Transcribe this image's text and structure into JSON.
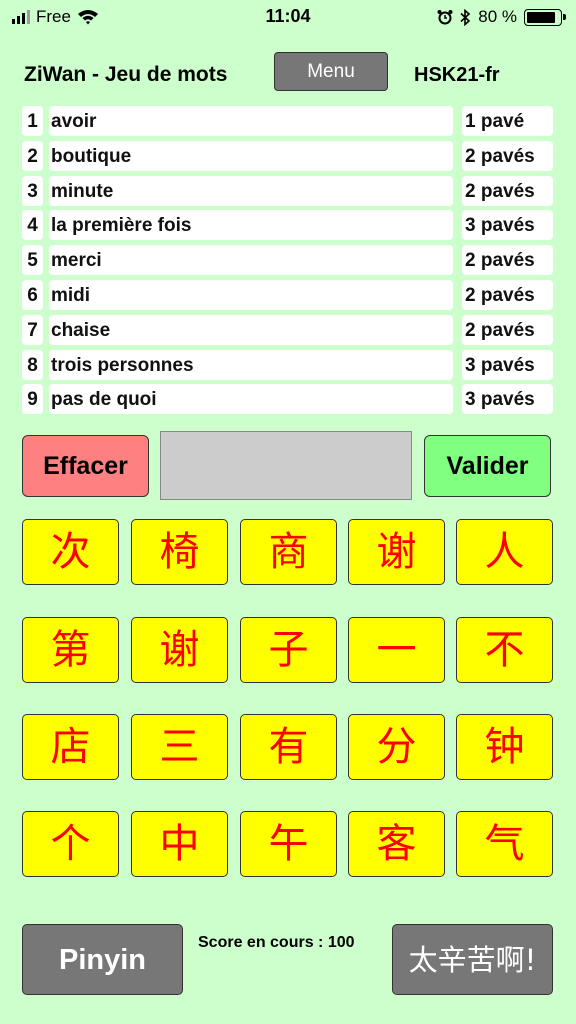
{
  "status_bar": {
    "carrier": "Free",
    "time": "11:04",
    "battery": "80 %",
    "battery_level": 0.8,
    "icons": [
      "signal-icon",
      "wifi-icon",
      "alarm-icon",
      "bluetooth-icon",
      "battery-icon"
    ]
  },
  "header": {
    "title": "ZiWan - Jeu de mots",
    "menu_label": "Menu",
    "level": "HSK21-fr"
  },
  "words": [
    {
      "num": "1",
      "text": "avoir",
      "count": "1 pavé"
    },
    {
      "num": "2",
      "text": "boutique",
      "count": "2 pavés"
    },
    {
      "num": "3",
      "text": "minute",
      "count": "2 pavés"
    },
    {
      "num": "4",
      "text": "la première fois",
      "count": "3 pavés"
    },
    {
      "num": "5",
      "text": "merci",
      "count": "2 pavés"
    },
    {
      "num": "6",
      "text": "midi",
      "count": "2 pavés"
    },
    {
      "num": "7",
      "text": "chaise",
      "count": "2 pavés"
    },
    {
      "num": "8",
      "text": "trois personnes",
      "count": "3 pavés"
    },
    {
      "num": "9",
      "text": "pas de quoi",
      "count": "3 pavés"
    }
  ],
  "controls": {
    "clear_label": "Effacer",
    "answer_value": "",
    "validate_label": "Valider"
  },
  "tiles": [
    [
      "次",
      "椅",
      "商",
      "谢",
      "人"
    ],
    [
      "第",
      "谢",
      "子",
      "一",
      "不"
    ],
    [
      "店",
      "三",
      "有",
      "分",
      "钟"
    ],
    [
      "个",
      "中",
      "午",
      "客",
      "气"
    ]
  ],
  "footer": {
    "pinyin_label": "Pinyin",
    "score_text": "Score en cours : 100",
    "hard_label": "太辛苦啊!"
  },
  "colors": {
    "background": "#ccffcc",
    "tile_bg": "#ffff00",
    "tile_text": "#ff0000",
    "clear_btn": "#ff8080",
    "validate_btn": "#80ff80",
    "gray_btn": "#777777"
  }
}
